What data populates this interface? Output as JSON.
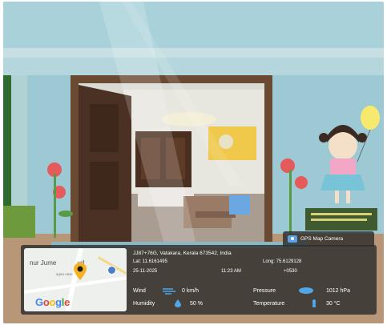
{
  "photo": {
    "colors": {
      "wall": "#9cc9d3",
      "door_frame": "#6b4a33",
      "floor": "#b79777",
      "overlay": "#2d2d2d"
    }
  },
  "stamp": {
    "app_name": "GPS Map Camera",
    "map_place": "nur Jume",
    "map_place_suffix": "ud",
    "map_code": "8QB1+SBX",
    "google_logo": "Google",
    "address": "JJ87+76G, Vatakara, Kerala 673542, India",
    "latitude": "Lat: 11.6161495",
    "longitude": "Long: 75.6129128",
    "date": "25-11-2025",
    "time": "11:23 AM",
    "timezone": "+0530",
    "wind_label": "Wind",
    "wind_value": "0 km/h",
    "pressure_label": "Pressure",
    "pressure_value": "1012 hPa",
    "humidity_label": "Humidity",
    "humidity_value": "50 %",
    "temperature_label": "Temperature",
    "temperature_value": "30 °C",
    "icons": [
      "camera-icon",
      "location-pin-icon",
      "wind-icon",
      "pressure-icon",
      "humidity-icon",
      "temperature-icon"
    ]
  }
}
